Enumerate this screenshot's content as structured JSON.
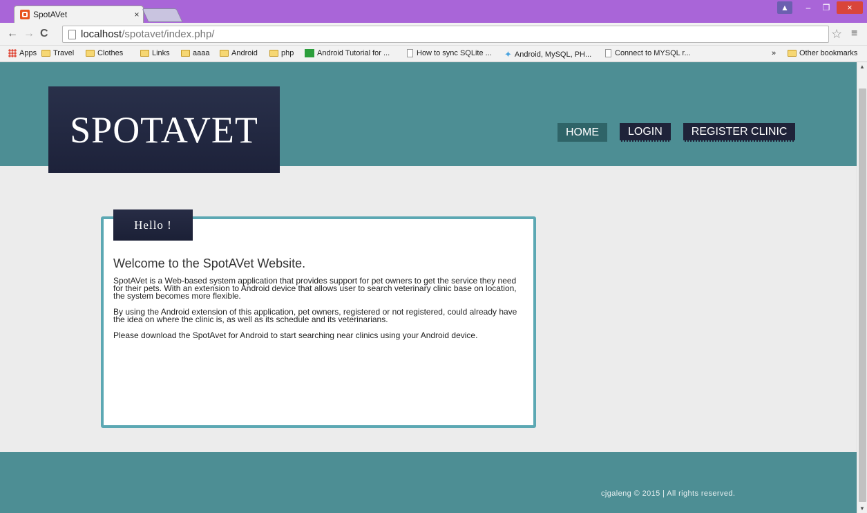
{
  "browser": {
    "tab_title": "SpotAVet",
    "tab_close": "×",
    "window_buttons": {
      "user": "▲",
      "minimize": "–",
      "restore": "❐",
      "close": "×"
    },
    "nav": {
      "back": "←",
      "forward": "→",
      "reload": "C"
    },
    "url_host": "localhost",
    "url_path": "/spotavet/index.php/",
    "star": "☆",
    "menu": "≡",
    "bookmarks": [
      {
        "label": "Apps",
        "icon": "apps-grid-icon"
      },
      {
        "label": "Travel",
        "icon": "folder-icon"
      },
      {
        "label": "Clothes",
        "icon": "folder-icon"
      },
      {
        "label": "Links",
        "icon": "folder-icon"
      },
      {
        "label": "aaaa",
        "icon": "folder-icon"
      },
      {
        "label": "Android",
        "icon": "folder-icon"
      },
      {
        "label": "php",
        "icon": "folder-icon"
      },
      {
        "label": "Android Tutorial for ...",
        "icon": "site-icon"
      },
      {
        "label": "How to sync SQLite ...",
        "icon": "page-icon"
      },
      {
        "label": "Android, MySQL, PH...",
        "icon": "star-icon"
      },
      {
        "label": "Connect to MYSQL r...",
        "icon": "page-icon"
      }
    ],
    "bookmarks_overflow": "»",
    "other_bookmarks": "Other bookmarks"
  },
  "site": {
    "logo": "SPOTAVET",
    "nav": [
      {
        "label": "HOME",
        "active": true
      },
      {
        "label": "LOGIN",
        "active": false
      },
      {
        "label": "REGISTER CLINIC",
        "active": false
      }
    ],
    "card": {
      "tab": "Hello !",
      "heading": "Welcome to the SpotAVet Website.",
      "paragraphs": [
        "SpotAVet is a Web-based system application that provides support for pet owners to get the service they need for their pets. With an extension to Android device that allows user to search veterinary clinic base on location, the system becomes more flexible.",
        "By using the Android extension of this application, pet owners, registered or not registered, could already have the idea on where the clinic is, as well as its schedule and its veterinarians.",
        "Please download the SpotAvet for Android to start searching near clinics using your Android device."
      ]
    },
    "footer": "cjgaleng © 2015 | All rights reserved."
  },
  "colors": {
    "titlebar": "#a965d8",
    "header": "#4d8e94",
    "navy": "#1f2339",
    "card_border": "#5ca8b3"
  }
}
